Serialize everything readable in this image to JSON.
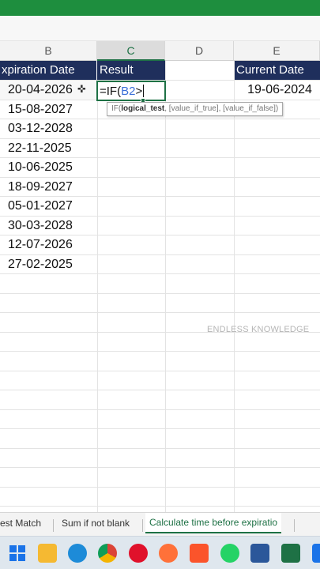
{
  "columns": {
    "b": "B",
    "c": "C",
    "d": "D",
    "e": "E"
  },
  "headers": {
    "expiration": "xpiration Date",
    "result": "Result",
    "current": "Current Date"
  },
  "current_date_value": "19-06-2024",
  "dates": [
    "20-04-2026",
    "15-08-2027",
    "03-12-2028",
    "22-11-2025",
    "10-06-2025",
    "18-09-2027",
    "05-01-2027",
    "30-03-2028",
    "12-07-2026",
    "27-02-2025"
  ],
  "formula": {
    "prefix": "=IF(",
    "ref": "B2",
    "suffix": ">"
  },
  "tooltip": {
    "fn": "IF(",
    "arg1": "logical_test",
    "rest": ", [value_if_true], [value_if_false])"
  },
  "watermark": "ENDLESS KNOWLEDGE",
  "sheet_tabs": [
    "est Match",
    "Sum if not blank",
    "Calculate time before expiratio"
  ],
  "colors": {
    "header_navy": "#1f2f5c",
    "excel_green": "#1e7145",
    "formula_ref": "#3b6fd8"
  },
  "taskbar_icons": [
    "windows-icon",
    "file-explorer-icon",
    "edge-icon",
    "chrome-icon",
    "opera-icon",
    "firefox-icon",
    "brave-icon",
    "whatsapp-icon",
    "word-icon",
    "excel-icon"
  ]
}
